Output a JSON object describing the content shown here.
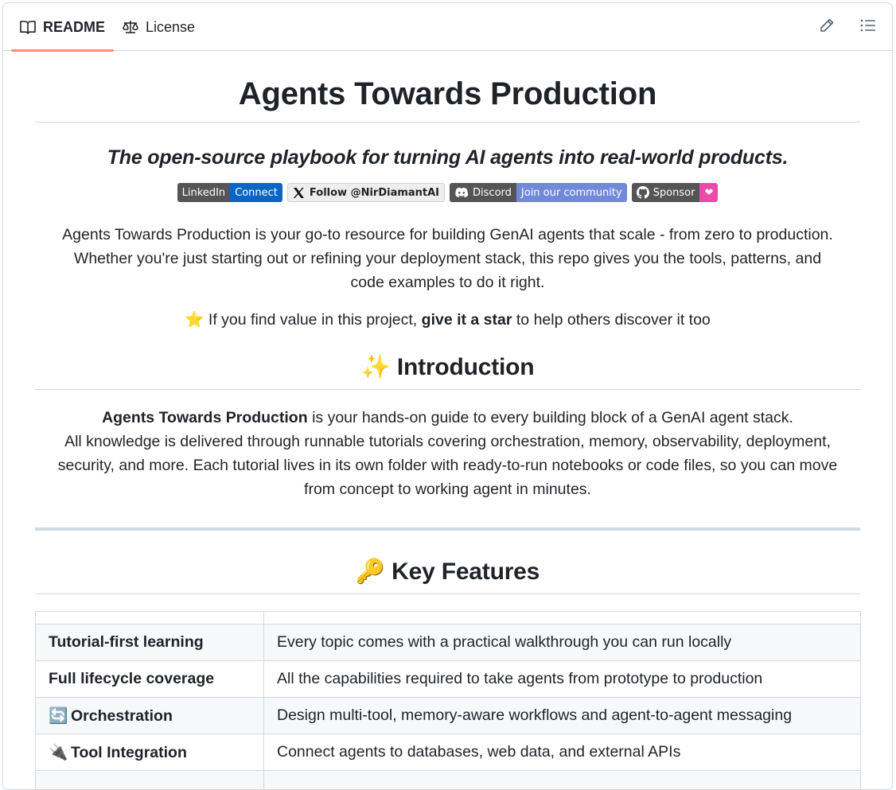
{
  "tabs": [
    {
      "label": "README",
      "icon": "book-icon"
    },
    {
      "label": "License",
      "icon": "scale-icon"
    }
  ],
  "actions": {
    "edit_icon": "pencil-icon",
    "outline_icon": "list-icon"
  },
  "readme": {
    "title": "Agents Towards Production",
    "tagline": "The open-source playbook for turning AI agents into real-world products.",
    "badges": [
      {
        "left": "LinkedIn",
        "right": "Connect"
      },
      {
        "left": "Follow @NirDiamantAI"
      },
      {
        "left": "Discord",
        "right": "Join our community"
      },
      {
        "left": "Sponsor",
        "right": "❤"
      }
    ],
    "intro_line1": "Agents Towards Production is your go-to resource for building GenAI agents that scale - from zero to production.",
    "intro_line2": "Whether you're just starting out or refining your deployment stack, this repo gives you the tools, patterns, and",
    "intro_line3": "code examples to do it right.",
    "star_emoji": "⭐",
    "star_pre": "If you find value in this project,",
    "star_bold": "give it a star",
    "star_post": "to help others discover it too",
    "introduction": {
      "emoji": "✨",
      "heading": "Introduction",
      "bold": "Agents Towards Production",
      "line1_rest": "is your hands-on guide to every building block of a GenAI agent stack.",
      "line2": "All knowledge is delivered through runnable tutorials covering orchestration, memory, observability, deployment,",
      "line3": "security, and more. Each tutorial lives in its own folder with ready-to-run notebooks or code files, so you can move",
      "line4": "from concept to working agent in minutes."
    },
    "key_features": {
      "emoji": "🔑",
      "heading": "Key Features",
      "rows": [
        {
          "emoji": "",
          "feature": "Tutorial-first learning",
          "description": "Every topic comes with a practical walkthrough you can run locally"
        },
        {
          "emoji": "",
          "feature": "Full lifecycle coverage",
          "description": "All the capabilities required to take agents from prototype to production"
        },
        {
          "emoji": "🔄",
          "feature": "Orchestration",
          "description": "Design multi-tool, memory-aware workflows and agent-to-agent messaging"
        },
        {
          "emoji": "🔌",
          "feature": "Tool Integration",
          "description": "Connect agents to databases, web data, and external APIs"
        }
      ]
    }
  }
}
